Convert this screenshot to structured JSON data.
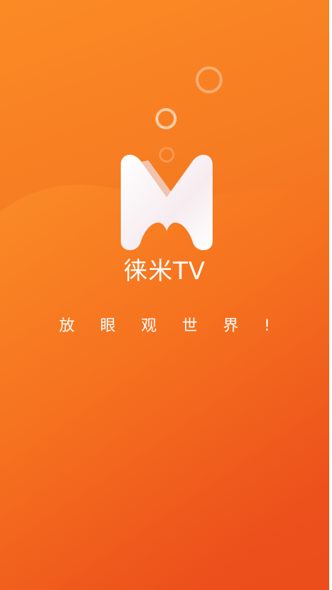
{
  "splash": {
    "app_name": "徕米TV",
    "slogan": "放眼观世界!",
    "logo_icon": "m-logo-icon",
    "colors": {
      "gradient_start": "#fb8a25",
      "gradient_end": "#ea481a",
      "text": "#ffffff"
    }
  }
}
